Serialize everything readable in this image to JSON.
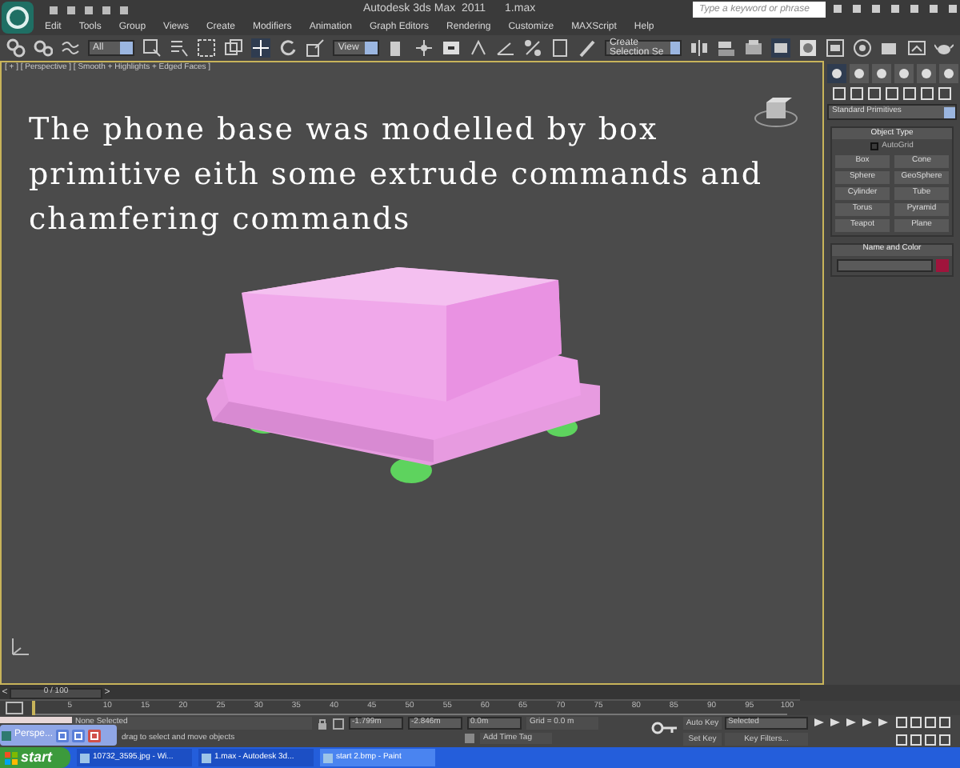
{
  "window": {
    "title": "Autodesk 3ds Max  2011",
    "file": "1.max"
  },
  "search": {
    "placeholder": "Type a keyword or phrase"
  },
  "menu": [
    "Edit",
    "Tools",
    "Group",
    "Views",
    "Create",
    "Modifiers",
    "Animation",
    "Graph Editors",
    "Rendering",
    "Customize",
    "MAXScript",
    "Help"
  ],
  "toolbar": {
    "filter": "All",
    "coordinate": "View",
    "selection_set": "Create Selection Se"
  },
  "viewport": {
    "label": "[ + ] [ Perspective ] [ Smooth + Highlights + Edged Faces ]",
    "annotation": "The phone base was modelled by box primitive eith some extrude commands and chamfering commands"
  },
  "command_panel": {
    "category": "Standard Primitives",
    "object_type": {
      "title": "Object Type",
      "autogrid": {
        "label": "AutoGrid",
        "checked": false
      },
      "buttons": [
        "Box",
        "Cone",
        "Sphere",
        "GeoSphere",
        "Cylinder",
        "Tube",
        "Torus",
        "Pyramid",
        "Teapot",
        "Plane"
      ]
    },
    "name_and_color": {
      "title": "Name and Color"
    }
  },
  "timeline": {
    "previous": "<",
    "next": ">",
    "position": "0 / 100",
    "level": 0,
    "ticks": [
      "5",
      "10",
      "15",
      "20",
      "25",
      "30",
      "35",
      "40",
      "45",
      "50",
      "55",
      "60",
      "65",
      "70",
      "75",
      "80",
      "85",
      "90",
      "95",
      "100"
    ]
  },
  "status": {
    "selection": "None Selected",
    "prompt": "drag to select and move objects",
    "x": "-1.799m",
    "y": "-2.846m",
    "z": "0.0m",
    "grid": "Grid = 0.0 m",
    "add_time_tag": "Add Time Tag"
  },
  "animation": {
    "auto_key": "Auto Key",
    "key_mode": "Selected",
    "set_key": "Set Key",
    "key_filters": "Key Filters..."
  },
  "mini_window": {
    "title": "Perspe..."
  },
  "taskbar": {
    "start": "start",
    "tasks": [
      {
        "label": "10732_3595.jpg - Wi...",
        "selected": false
      },
      {
        "label": "1.max - Autodesk 3d...",
        "selected": false
      },
      {
        "label": "start 2.bmp - Paint",
        "selected": true
      }
    ]
  }
}
